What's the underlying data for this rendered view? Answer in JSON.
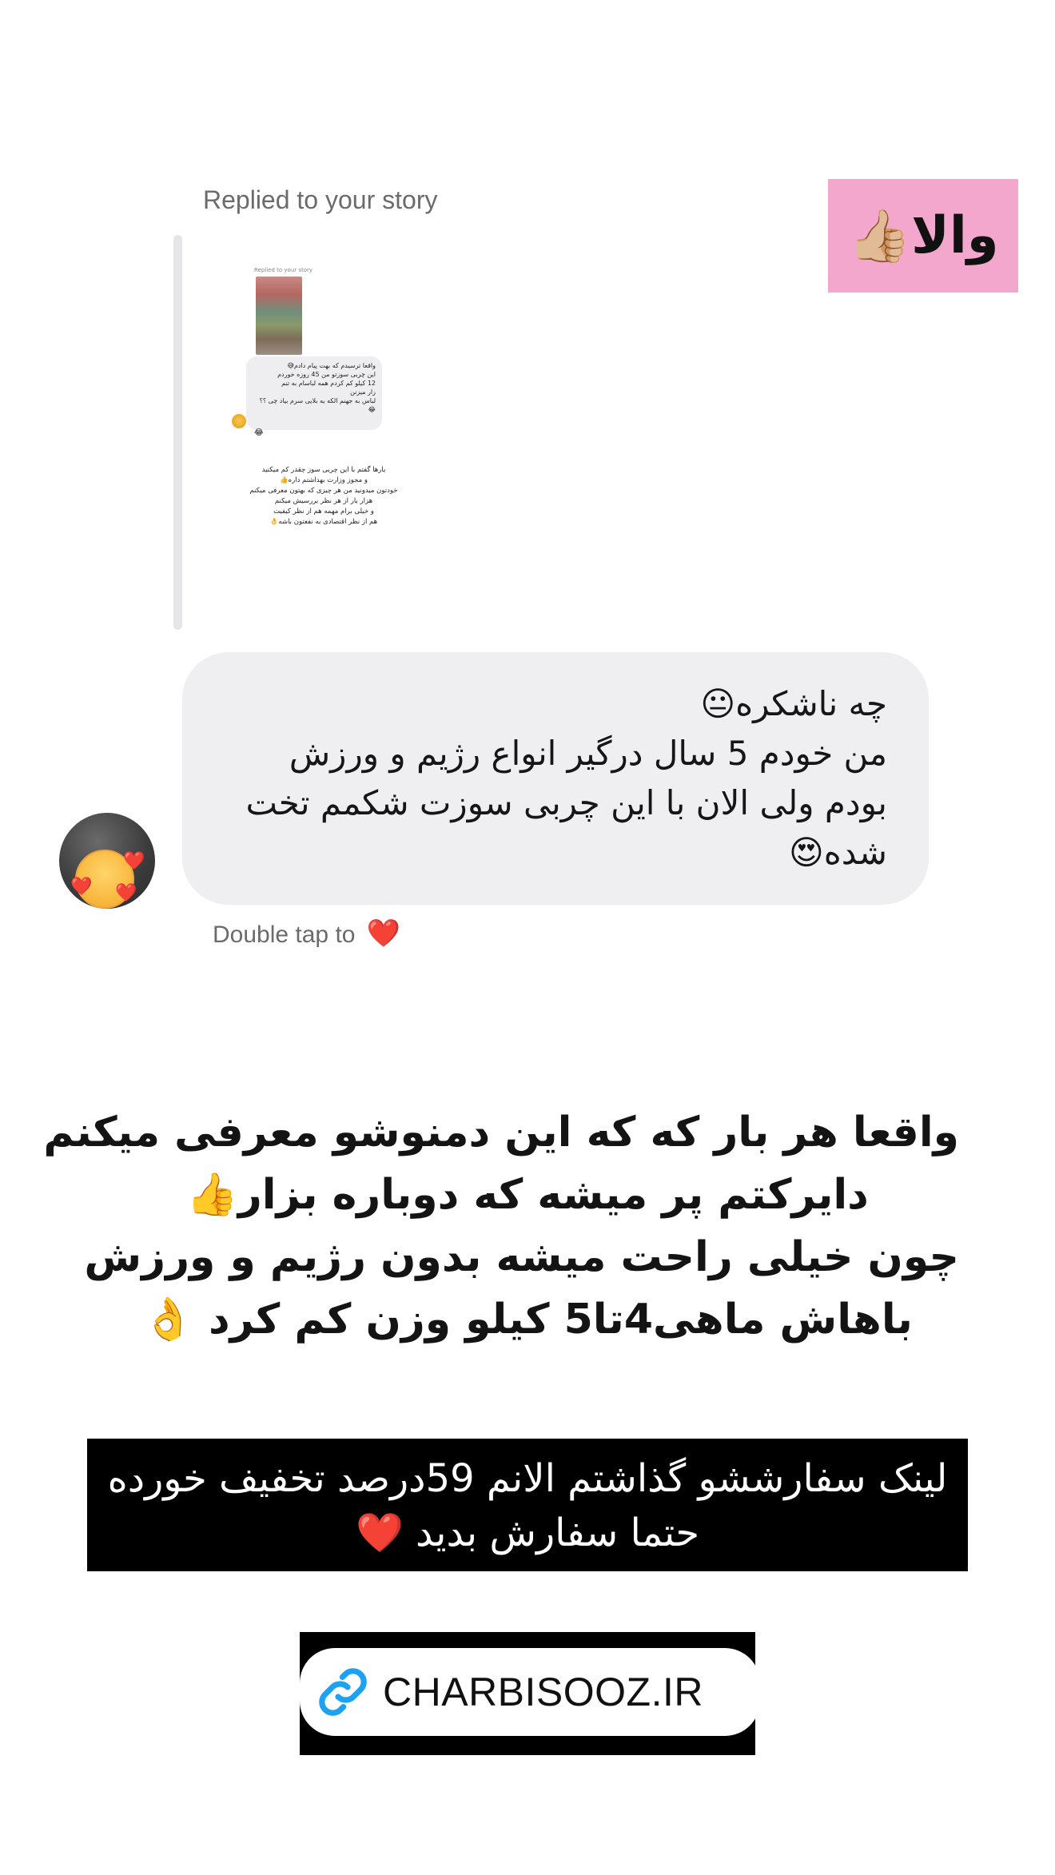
{
  "sticker": {
    "text": "والا",
    "emoji": "👍🏼"
  },
  "reply": {
    "label": "Replied to your story"
  },
  "mini_story": {
    "replied_label": "Replied to your story",
    "bubble_lines": [
      "واقعا ترسیدم که بهت پیام دادم😅",
      "این چربی سوزتو من 45 روزه خوردم",
      "12 کیلو کم کردم همه لباسام به تنم",
      "زار میزنن",
      "لباس به جهنم الکه یه بلایی سرم بیاد چی ؟؟",
      "😂"
    ],
    "bubble_emoji": "😂",
    "text_lines": [
      "بارها گفتم با این چربی سوز چقدر کم میکنید",
      "و مجوز وزارت بهداشتم داره👍",
      "خودتون میدونید من هر چیزی که بهتون معرفی میکنم",
      "هزار بار از هر نظر بررسیش میکنم",
      "و خیلی برام مهمه هم از نظر کیفیت",
      "هم از نظر اقتصادی به نفعتون باشه👌"
    ]
  },
  "message": {
    "lines": [
      "چه ناشکره😐",
      "من خودم 5 سال درگیر انواع رژیم و ورزش",
      "بودم ولی الان با این چربی سوزت شکمم تخت",
      "شده😍"
    ]
  },
  "avatar": {
    "emoji": "☺️",
    "hearts": "❤️"
  },
  "double_tap": {
    "text": "Double tap to",
    "heart": "❤️"
  },
  "caption": {
    "lines": [
      "واقعا هر بار که که این دمنوشو معرفی میکنم",
      "دایرکتم پر میشه که دوباره بزار👍",
      "چون خیلی راحت میشه بدون رژیم و ورزش",
      "باهاش ماهی4تا5 کیلو وزن کم کرد 👌"
    ]
  },
  "banner": {
    "line1": "لینک سفارششو گذاشتم الانم 59درصد تخفیف خورده",
    "line2": "حتما سفارش بدید",
    "heart": "❤️"
  },
  "link": {
    "text": "CHARBISOOZ.IR",
    "icon": "link-icon",
    "icon_color": "#1da1f2"
  },
  "colors": {
    "sticker_bg": "#f4a7cd",
    "bubble_bg": "#efeff1",
    "banner_bg": "#000000"
  }
}
